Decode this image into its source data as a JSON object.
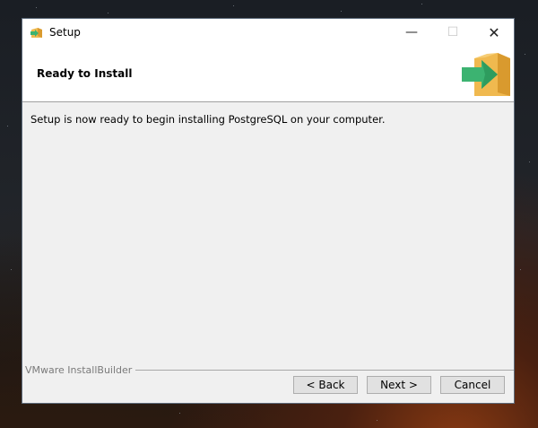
{
  "window": {
    "title": "Setup",
    "controls": {
      "minimize": "—",
      "maximize": "☐",
      "close": "✕"
    }
  },
  "header": {
    "title": "Ready to Install",
    "icon": "installer-box-arrow-icon"
  },
  "main": {
    "message": "Setup is now ready to begin installing PostgreSQL on your computer."
  },
  "footer": {
    "branding": "VMware InstallBuilder",
    "buttons": {
      "back": "< Back",
      "next": "Next >",
      "cancel": "Cancel"
    }
  },
  "colors": {
    "box": "#f0b94f",
    "arrow": "#3cb371"
  }
}
